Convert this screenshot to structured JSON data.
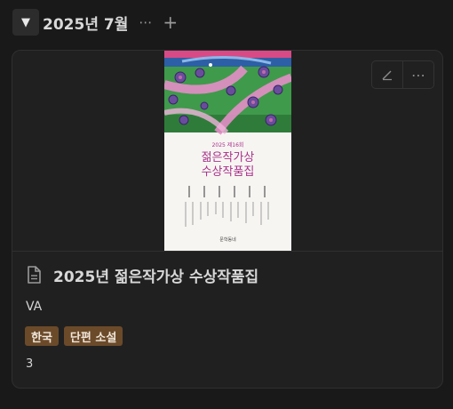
{
  "group": {
    "toggle_icon": "triangle-down-icon",
    "title": "2025년 7월",
    "more_icon": "ellipsis-icon",
    "add_icon": "plus-icon"
  },
  "card": {
    "actions": [
      "edit-icon",
      "more-icon"
    ],
    "cover": {
      "series_line": "2025 제16회",
      "title_line1": "젊은작가상",
      "title_line2": "수상작품집",
      "publisher": "문학동네",
      "colors": {
        "sky": "#2d5fa6",
        "foliage": "#3f9a4b",
        "flower": "#6a4c9c",
        "title": "#a8318a"
      }
    },
    "title": "2025년 젊은작가상 수상작품집",
    "author": "VA",
    "tags": [
      {
        "label": "한국",
        "color": "#6b4a2a"
      },
      {
        "label": "단편 소설",
        "color": "#6b4a2a"
      }
    ],
    "count": "3"
  }
}
